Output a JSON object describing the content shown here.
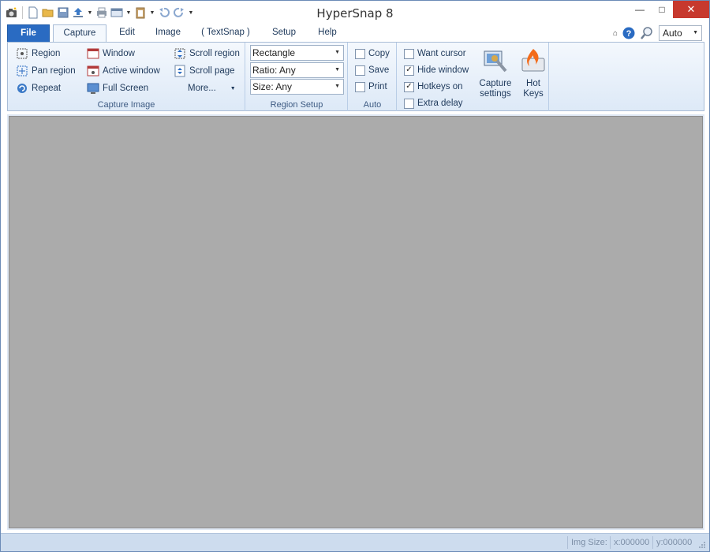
{
  "app": {
    "title": "HyperSnap 8"
  },
  "window_controls": {
    "minimize": "—",
    "maximize": "□",
    "close": "✕"
  },
  "tabs": [
    {
      "label": "File"
    },
    {
      "label": "Capture"
    },
    {
      "label": "Edit"
    },
    {
      "label": "Image"
    },
    {
      "label": "( TextSnap )"
    },
    {
      "label": "Setup"
    },
    {
      "label": "Help"
    }
  ],
  "zoom": {
    "value": "Auto"
  },
  "groups": {
    "capture_image": {
      "label": "Capture Image",
      "items": [
        "Region",
        "Pan region",
        "Repeat",
        "Window",
        "Active window",
        "Full Screen",
        "Scroll region",
        "Scroll page",
        "More..."
      ]
    },
    "region_setup": {
      "label": "Region Setup",
      "shape": "Rectangle",
      "ratio": "Ratio: Any",
      "size": "Size: Any"
    },
    "auto": {
      "label": "Auto",
      "options": [
        {
          "label": "Copy",
          "checked": false
        },
        {
          "label": "Save",
          "checked": false
        },
        {
          "label": "Print",
          "checked": false
        }
      ]
    },
    "settings": {
      "options": [
        {
          "label": "Want cursor",
          "checked": false
        },
        {
          "label": "Hide window",
          "checked": true
        },
        {
          "label": "Hotkeys on",
          "checked": true
        },
        {
          "label": "Extra delay",
          "checked": false
        }
      ],
      "capture_settings": "Capture settings",
      "hot_keys": "Hot Keys"
    }
  },
  "statusbar": {
    "img_size": "Img Size:",
    "x": "x:000000",
    "y": "y:000000"
  },
  "icons": {
    "qat": [
      "camera-icon",
      "new-file-icon",
      "open-folder-icon",
      "save-icon",
      "upload-icon",
      "print-icon",
      "window-list-icon",
      "clipboard-icon",
      "undo-icon",
      "redo-icon"
    ],
    "help": "help-icon",
    "zoom": "magnifier-icon"
  },
  "colors": {
    "accent": "#2a6bc2",
    "close": "#c7392e",
    "workspace": "#ababab",
    "ribbon": "#dde9f7"
  }
}
